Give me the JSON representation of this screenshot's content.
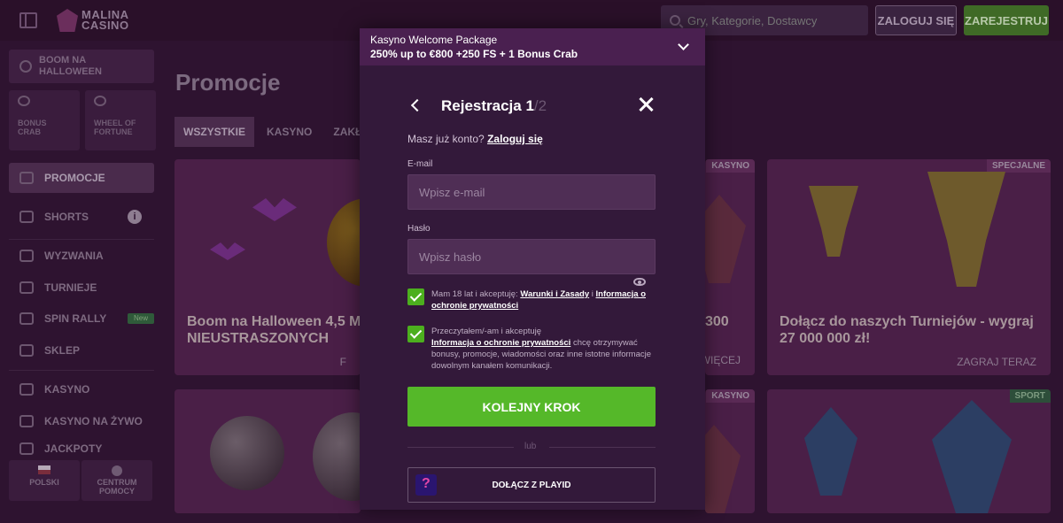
{
  "header": {
    "logo_line1": "MALINA",
    "logo_line2": "CASINO",
    "search_placeholder": "Gry, Kategorie, Dostawcy",
    "login_label": "ZALOGUJ SIĘ",
    "register_label": "ZAREJESTRUJ"
  },
  "sidebar": {
    "promo_label": "BOOM NA HALLOWEEN",
    "tiles": [
      {
        "label": "BONUS CRAB"
      },
      {
        "label": "WHEEL OF FORTUNE"
      }
    ],
    "items": [
      {
        "label": "PROMOCJE"
      },
      {
        "label": "SHORTS"
      },
      {
        "label": "WYZWANIA"
      },
      {
        "label": "TURNIEJE"
      },
      {
        "label": "SPIN RALLY",
        "badge": "New"
      },
      {
        "label": "SKLEP"
      },
      {
        "label": "KASYNO"
      },
      {
        "label": "KASYNO NA ŻYWO"
      },
      {
        "label": "JACKPOTY"
      }
    ],
    "bottom": [
      {
        "label": "POLSKI"
      },
      {
        "label": "CENTRUM POMOCY"
      }
    ]
  },
  "main": {
    "title": "Promocje",
    "tabs": [
      "WSZYSTKIE",
      "KASYNO",
      "ZAKŁAD"
    ],
    "cards": [
      {
        "title": "Boom na Halloween 4,5 M",
        "title2": "NIEUSTRASZONYCH",
        "cta": "F"
      },
      {
        "tag": "KASYNO",
        "title": "300",
        "cta": "WIĘCEJ"
      },
      {
        "tag": "SPECJALNE",
        "title": "Dołącz do naszych Turniejów - wygraj",
        "title2": "27 000 000 zł!",
        "cta": "ZAGRAJ TERAZ"
      },
      {
        "tag": "KASYNO"
      },
      {
        "tag": "SPORT"
      }
    ]
  },
  "modal": {
    "banner_title": "Kasyno Welcome Package",
    "banner_offer": "250% up to €800 +250 FS + 1 Bonus Crab",
    "title": "Rejestracja 1",
    "title_step": "/2",
    "have_account": "Masz już konto?",
    "login_link": "Zaloguj się",
    "email_label": "E-mail",
    "email_placeholder": "Wpisz e-mail",
    "password_label": "Hasło",
    "password_placeholder": "Wpisz hasło",
    "consent1_text": "Mam 18 lat i akceptuję:",
    "consent1_link1": "Warunki i Zasady",
    "consent1_and": "i",
    "consent1_link2": "Informacja o ochronie prywatności",
    "consent2_text": "Przeczytałem/-am i akceptuję",
    "consent2_link": "Informacja o ochronie prywatności",
    "consent2_rest": "chcę otrzymywać bonusy, promocje, wiadomości oraz inne istotne informacje dowolnym kanałem komunikacji.",
    "next_label": "KOLEJNY KROK",
    "or_label": "lub",
    "playid_label": "DOŁĄCZ Z PLAYID"
  }
}
